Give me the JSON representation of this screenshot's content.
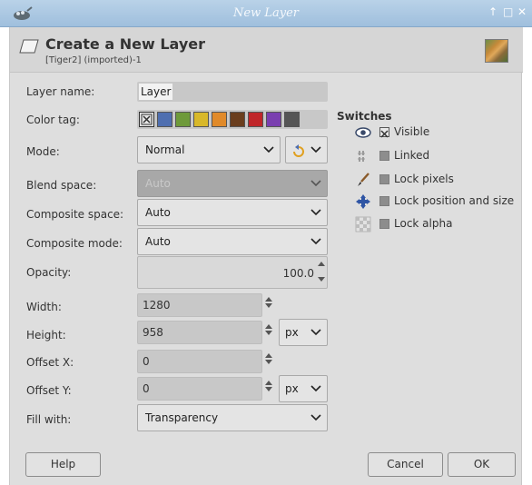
{
  "window": {
    "title": "New Layer"
  },
  "header": {
    "title": "Create a New Layer",
    "subtitle": "[Tiger2] (imported)-1"
  },
  "labels": {
    "layer_name": "Layer name:",
    "color_tag": "Color tag:",
    "mode": "Mode:",
    "blend_space": "Blend space:",
    "composite_space": "Composite space:",
    "composite_mode": "Composite mode:",
    "opacity": "Opacity:",
    "width": "Width:",
    "height": "Height:",
    "offset_x": "Offset X:",
    "offset_y": "Offset Y:",
    "fill_with": "Fill with:"
  },
  "values": {
    "layer_name": "Layer",
    "mode": "Normal",
    "blend_space": "Auto",
    "composite_space": "Auto",
    "composite_mode": "Auto",
    "opacity": "100.0",
    "width": "1280",
    "height": "958",
    "size_unit": "px",
    "offset_x": "0",
    "offset_y": "0",
    "offset_unit": "px",
    "fill_with": "Transparency"
  },
  "color_tags": [
    "#4f6fb0",
    "#6e9a3a",
    "#d8b82a",
    "#e08a2a",
    "#6a3e1e",
    "#c0262a",
    "#7a3fb0",
    "#555555"
  ],
  "switches": {
    "heading": "Switches",
    "items": [
      {
        "label": "Visible",
        "checked": true,
        "icon": "eye-icon"
      },
      {
        "label": "Linked",
        "checked": false,
        "icon": "chain-icon"
      },
      {
        "label": "Lock pixels",
        "checked": false,
        "icon": "paintbrush-icon"
      },
      {
        "label": "Lock position and size",
        "checked": false,
        "icon": "move-icon"
      },
      {
        "label": "Lock alpha",
        "checked": false,
        "icon": "checkerboard-icon"
      }
    ]
  },
  "buttons": {
    "help": "Help",
    "cancel": "Cancel",
    "ok": "OK"
  }
}
